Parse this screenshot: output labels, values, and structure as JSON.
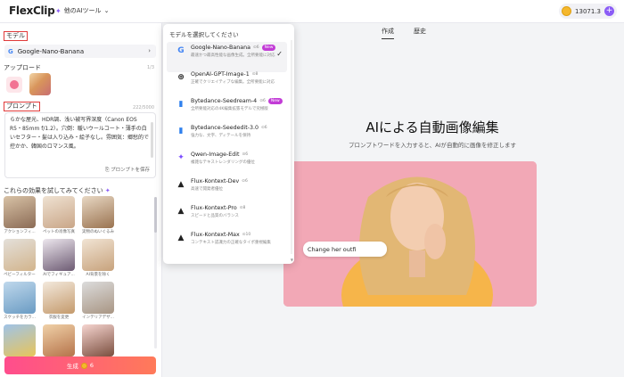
{
  "app": {
    "logo": "FlexClip",
    "tools_menu": "他のAIツール",
    "credits": "13071.3"
  },
  "left": {
    "model_label": "モデル",
    "model_selected": "Google-Nano-Banana",
    "upload_label": "アップロード",
    "upload_count": "1/3",
    "prompt_label": "プロンプト",
    "prompt_count": "222/5000",
    "prompt_text": "らかな屋光、HDR調、浅い被写界深度（Canon EOS R5・85mm f/1.2）。穴倒：暖いウールコート・薄手の白いセフター・髪は入り込み・絵子なし。雰囲気：郷愁的で控かか、韓国のロマンス風。",
    "prompt_save": "プロンプトを保存",
    "effects_label": "これらの効果を試してみてください",
    "effects": [
      {
        "caption": "アクションフィ...",
        "colors": [
          "#d8c2a6",
          "#8b6b55"
        ]
      },
      {
        "caption": "ペットの肖像写真",
        "colors": [
          "#efe2d2",
          "#c9a688"
        ]
      },
      {
        "caption": "実物のぬいぐるみ",
        "colors": [
          "#e8d8c4",
          "#9a7350"
        ]
      },
      {
        "caption": "ペビーフィルター",
        "colors": [
          "#e4e0da",
          "#d2b48c"
        ]
      },
      {
        "caption": "AIでフィギュア...",
        "colors": [
          "#ede7ee",
          "#6d5b73"
        ]
      },
      {
        "caption": "AI背景を除く",
        "colors": [
          "#f1e4d4",
          "#c7a27c"
        ]
      },
      {
        "caption": "スケッチをカラ...",
        "colors": [
          "#bfd8ec",
          "#6a9bc3"
        ]
      },
      {
        "caption": "衣服を変更",
        "colors": [
          "#f3e9dd",
          "#c49a6c"
        ]
      },
      {
        "caption": "インテリアデザ...",
        "colors": [
          "#dcdcdc",
          "#a89583"
        ]
      },
      {
        "caption": "",
        "colors": [
          "#9fc3e8",
          "#e8c55a"
        ]
      },
      {
        "caption": "",
        "colors": [
          "#f0d1a8",
          "#b5734a"
        ]
      },
      {
        "caption": "",
        "colors": [
          "#f6d5d0",
          "#7a4e3e"
        ]
      }
    ],
    "generate_label": "生成",
    "generate_cost": "6"
  },
  "main": {
    "tab_create": "作成",
    "tab_history": "歴史",
    "title": "AIによる自動画像編集",
    "subtitle": "プロンプトワードを入力すると、AIが自動的に画像を修正します",
    "bubble_text": "Change her outfi"
  },
  "dropdown": {
    "title": "モデルを選択してください",
    "items": [
      {
        "name": "Google-Nano-Banana",
        "credit": "6",
        "badge": "New",
        "desc": "最速かつ最高性能な画像生成。全所要能に対応",
        "icon": "G",
        "icon_color": "#4285f4",
        "selected": true
      },
      {
        "name": "OpenAI-GPT-Image-1",
        "credit": "8",
        "badge": "",
        "desc": "正確でクリエイティブな編集。全所要能に対応",
        "icon": "⊛",
        "icon_color": "#222",
        "selected": false
      },
      {
        "name": "Bytedance-Seedream-4",
        "credit": "6",
        "badge": "New",
        "desc": "全所要能対応の4K編集拡張モデルで究極版",
        "icon": "▮",
        "icon_color": "#2f80ed",
        "selected": false
      },
      {
        "name": "Bytedance-Seededit-3.0",
        "credit": "6",
        "badge": "",
        "desc": "強力な、文字、ディテールを保持",
        "icon": "▮",
        "icon_color": "#2f80ed",
        "selected": false
      },
      {
        "name": "Qwen-Image-Edit",
        "credit": "6",
        "badge": "",
        "desc": "複雑なテキストレンダリングの優位",
        "icon": "✦",
        "icon_color": "#7c4dff",
        "selected": false
      },
      {
        "name": "Flux-Kontext-Dev",
        "credit": "6",
        "badge": "",
        "desc": "高速で開発者優位",
        "icon": "▲",
        "icon_color": "#222",
        "selected": false
      },
      {
        "name": "Flux-Kontext-Pro",
        "credit": "8",
        "badge": "",
        "desc": "スピードと品質のバランス",
        "icon": "▲",
        "icon_color": "#222",
        "selected": false
      },
      {
        "name": "Flux-Kontext-Max",
        "credit": "10",
        "badge": "",
        "desc": "コンテキスト認識力の正確なタイポ重視編集",
        "icon": "▲",
        "icon_color": "#222",
        "selected": false
      }
    ]
  }
}
